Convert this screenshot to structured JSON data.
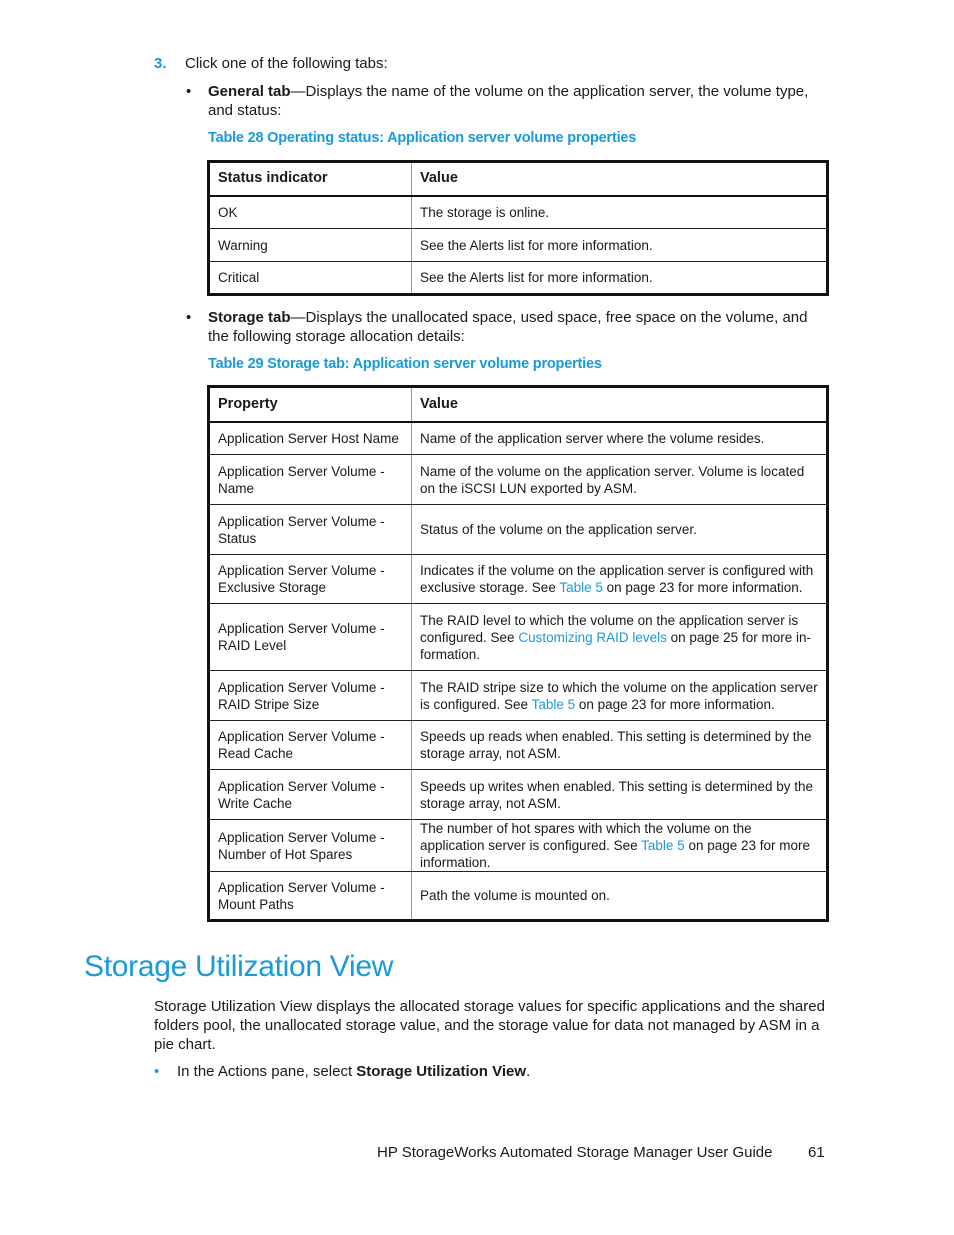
{
  "step": {
    "number": "3.",
    "text": "Click one of the following tabs:"
  },
  "general_tab": {
    "bullet": "•",
    "label": "General tab",
    "text": "—Displays the name of the volume on the application server, the volume type, and status:"
  },
  "table28": {
    "caption": "Table 28 Operating status: Application server volume properties",
    "headers": [
      "Status indicator",
      "Value"
    ],
    "rows": [
      [
        "OK",
        "The storage is online."
      ],
      [
        "Warning",
        "See the Alerts list for more information."
      ],
      [
        "Critical",
        "See the Alerts list for more information."
      ]
    ]
  },
  "storage_tab": {
    "bullet": "•",
    "label": "Storage tab",
    "text": "—Displays the unallocated space, used space, free space on the volume, and the following storage allocation details:"
  },
  "table29": {
    "caption": "Table 29 Storage tab: Application server volume properties",
    "headers": [
      "Property",
      "Value"
    ],
    "rows": [
      {
        "property": "Application Server Host Name",
        "value": [
          "Name of the application server where the volume resides."
        ]
      },
      {
        "property": "Application Server Volume - Name",
        "value": [
          "Name of the volume on the application server. Volume is located on the iSCSI LUN exported by ASM."
        ]
      },
      {
        "property": "Application Server Volume - Status",
        "value": [
          "Status of the volume on the application server."
        ]
      },
      {
        "property": "Application Server Volume - Exclusive Storage",
        "value": [
          "Indicates if the volume on the application server is configured with exclusive storage. See ",
          "Table 5",
          " on page 23 for more information."
        ]
      },
      {
        "property": "Application Server Volume - RAID Level",
        "value": [
          "The RAID level to which the volume on the application server is configured. See ",
          "Customizing RAID levels",
          " on page 25 for more in-formation."
        ]
      },
      {
        "property": "Application Server Volume - RAID Stripe Size",
        "value": [
          "The RAID stripe size to which the volume on the application server is configured. See ",
          "Table 5",
          " on page 23 for more information."
        ]
      },
      {
        "property": "Application Server Volume - Read Cache",
        "value": [
          "Speeds up reads when enabled. This setting is determined by the storage array, not ASM."
        ]
      },
      {
        "property": "Application Server Volume - Write Cache",
        "value": [
          "Speeds up writes when enabled. This setting is determined by the storage array, not ASM."
        ]
      },
      {
        "property": "Application Server Volume - Number of Hot Spares",
        "value": [
          "The number of hot spares with which the volume on the application server is configured. See ",
          "Table 5",
          " on page 23 for more information."
        ]
      },
      {
        "property": "Application Server Volume - Mount Paths",
        "value": [
          "Path the volume is mounted on."
        ]
      }
    ]
  },
  "section": {
    "title": "Storage Utilization View",
    "paragraph": "Storage Utilization View displays the allocated storage values for specific applications and the shared folders pool, the unallocated storage value, and the storage value for data not managed by ASM in a pie chart.",
    "action_bullet": "•",
    "action_prefix": "In the Actions pane, select ",
    "action_bold": "Storage Utilization View",
    "action_suffix": "."
  },
  "footer": {
    "title": "HP StorageWorks Automated Storage Manager User Guide",
    "page": "61"
  },
  "colors": {
    "accent": "#1a9ad6",
    "text": "#1a1a1a"
  }
}
